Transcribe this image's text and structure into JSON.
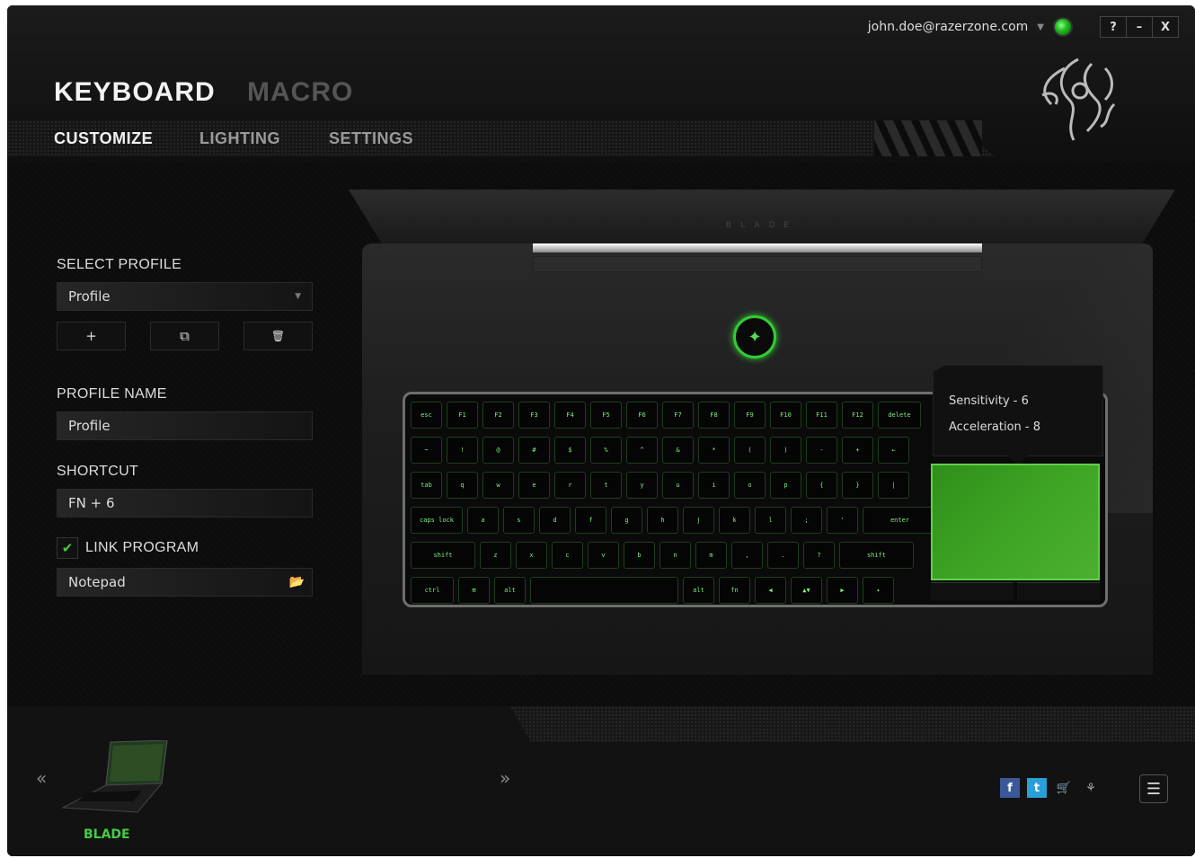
{
  "titlebar": {
    "account_email": "john.doe@razerzone.com",
    "account_caret": "▼",
    "help_label": "?",
    "minimize_label": "–",
    "close_label": "X"
  },
  "main_tabs": [
    {
      "label": "KEYBOARD",
      "active": true
    },
    {
      "label": "MACRO",
      "active": false
    }
  ],
  "sub_tabs": [
    {
      "label": "CUSTOMIZE",
      "active": true
    },
    {
      "label": "LIGHTING",
      "active": false
    },
    {
      "label": "SETTINGS",
      "active": false
    }
  ],
  "left_panel": {
    "select_profile_label": "SELECT PROFILE",
    "profile_dropdown_value": "Profile",
    "dropdown_arrow": "▼",
    "add_label": "+",
    "copy_label": "⧉",
    "delete_label": "🗑",
    "profile_name_label": "PROFILE NAME",
    "profile_name_value": "Profile",
    "shortcut_label": "SHORTCUT",
    "shortcut_value": "FN + 6",
    "link_program_label": "LINK PROGRAM",
    "link_program_checked": true,
    "check_mark": "✔",
    "program_value": "Notepad",
    "folder_icon": "📂"
  },
  "laptop": {
    "lid_text": "BLADE",
    "power_glyph": "✦",
    "trackpad_tooltip": {
      "sensitivity": "Sensitivity - 6",
      "acceleration": "Acceleration - 8"
    },
    "keyboard_rows": [
      [
        "esc",
        "F1",
        "F2",
        "F3",
        "F4",
        "F5",
        "F6",
        "F7",
        "F8",
        "F9",
        "F10",
        "F11",
        "F12",
        "delete"
      ],
      [
        "~",
        "!",
        "@",
        "#",
        "$",
        "%",
        "^",
        "&",
        "*",
        "(",
        ")",
        "-",
        "+",
        "←"
      ],
      [
        "tab",
        "q",
        "w",
        "e",
        "r",
        "t",
        "y",
        "u",
        "i",
        "o",
        "p",
        "{",
        "}",
        "|"
      ],
      [
        "caps lock",
        "a",
        "s",
        "d",
        "f",
        "g",
        "h",
        "j",
        "k",
        "l",
        ";",
        "'",
        "enter"
      ],
      [
        "shift",
        "z",
        "x",
        "c",
        "v",
        "b",
        "n",
        "m",
        ",",
        ".",
        "?",
        "shift"
      ],
      [
        "ctrl",
        "⊞",
        "alt",
        "",
        "alt",
        "fn",
        "◀",
        "▲▼",
        "▶",
        "✦"
      ]
    ]
  },
  "footer": {
    "prev_arrow": "«",
    "next_arrow": "»",
    "device_name": "BLADE",
    "social": {
      "facebook": "f",
      "twitter": "t",
      "store": "🛒",
      "razer": "⚘"
    },
    "menu_glyph": "☰"
  },
  "colors": {
    "accent": "#44cc44",
    "background": "#0c0c0c"
  }
}
